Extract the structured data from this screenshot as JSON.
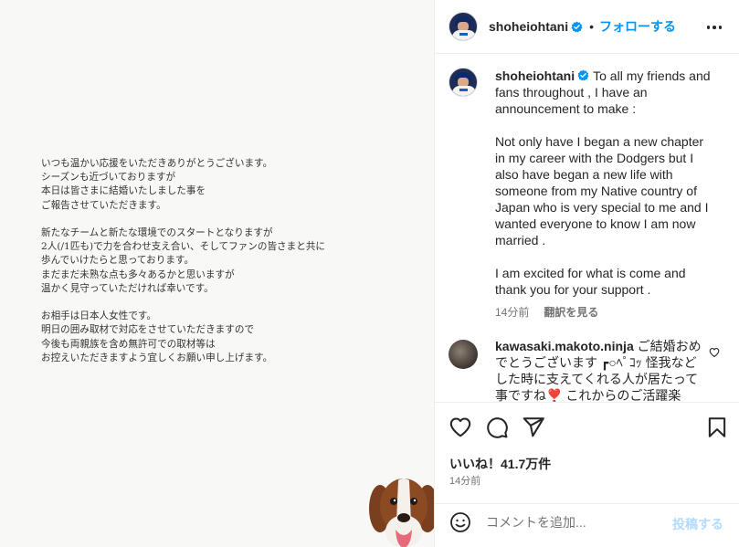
{
  "letter": {
    "paragraphs": [
      [
        "いつも温かい応援をいただきありがとうございます。",
        "シーズンも近づいておりますが",
        "本日は皆さまに結婚いたしました事を",
        "ご報告させていただきます。"
      ],
      [
        "新たなチームと新たな環境でのスタートとなりますが",
        "2人(/1匹も)で力を合わせ支え合い、そしてファンの皆さまと共に",
        "歩んでいけたらと思っております。",
        "まだまだ未熟な点も多々あるかと思いますが",
        "温かく見守っていただければ幸いです。"
      ],
      [
        "お相手は日本人女性です。",
        "明日の囲み取材で対応をさせていただきますので",
        "今後も両親族を含め無許可での取材等は",
        "お控えいただきますよう宜しくお願い申し上げます。"
      ]
    ]
  },
  "header": {
    "username": "shoheiohtani",
    "separator": "•",
    "follow_label": "フォローする"
  },
  "caption": {
    "username": "shoheiohtani",
    "lines": [
      "To all my friends and",
      "fans throughout , I have an",
      "announcement to make :",
      "",
      "Not only have I began a new chapter",
      "in my career with the Dodgers but I",
      "also have began a new life with",
      "someone from my Native country of",
      "Japan who is very special to me and I",
      "wanted everyone to know I am now",
      "married .",
      "",
      "I am excited for what is come and",
      "thank you for your support ."
    ],
    "time": "14分前",
    "translate_label": "翻訳を見る"
  },
  "comment": {
    "username": "kawasaki.makoto.ninja",
    "lines": [
      "ご結婚おめ",
      "でとうございます ┏○ﾍﾟｺｯ 怪我など",
      "した時に支えてくれる人が居たって",
      "事ですね❣️ これからのご活躍楽"
    ]
  },
  "likes": {
    "label": "いいね！",
    "count": "41.7万件"
  },
  "post_time": "14分前",
  "comment_bar": {
    "placeholder": "コメントを追加...",
    "post_label": "投稿する"
  },
  "colors": {
    "accent": "#0095f6",
    "post_disabled": "#b3dbff",
    "verified": "#0095f6",
    "heart_red": "#ed4956"
  },
  "icons": [
    "verified-icon",
    "more-options-icon",
    "heart-icon",
    "comment-icon",
    "share-icon",
    "bookmark-icon",
    "emoji-icon"
  ]
}
